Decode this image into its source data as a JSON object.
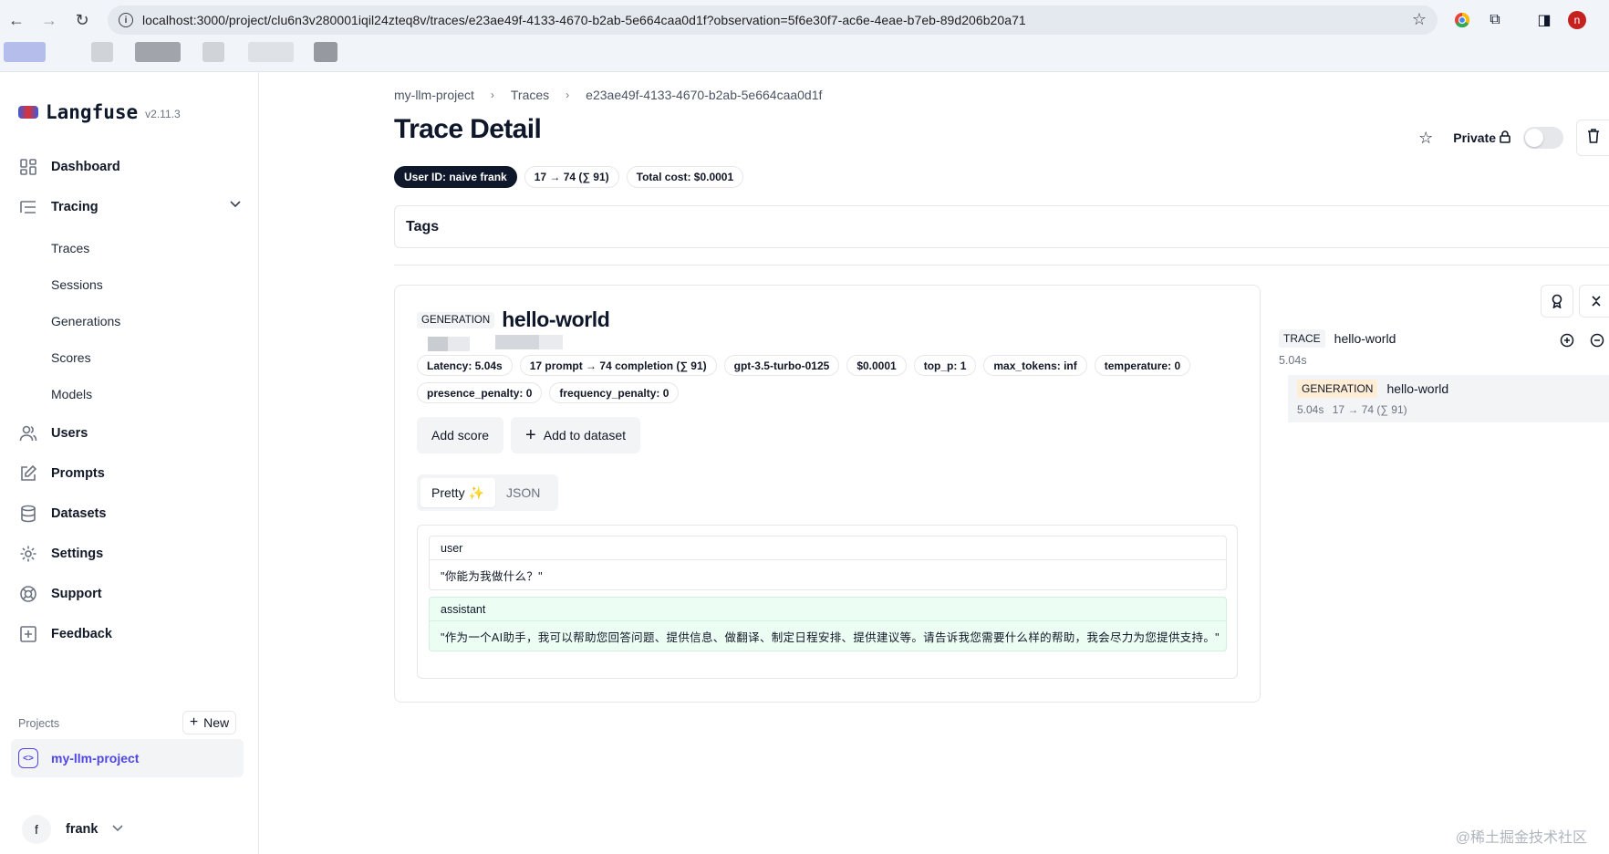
{
  "browser": {
    "url": "localhost:3000/project/clu6n3v280001iqil24zteq8v/traces/e23ae49f-4133-4670-b2ab-5e664caa0d1f?observation=5f6e30f7-ac6e-4eae-b7eb-89d206b20a71",
    "profile_initial": "n"
  },
  "sidebar": {
    "brand": "Langfuse",
    "version": "v2.11.3",
    "items": [
      {
        "label": "Dashboard",
        "icon": "dashboard-icon"
      },
      {
        "label": "Tracing",
        "icon": "tracing-icon"
      },
      {
        "label": "Users",
        "icon": "users-icon"
      },
      {
        "label": "Prompts",
        "icon": "prompts-icon"
      },
      {
        "label": "Datasets",
        "icon": "datasets-icon"
      },
      {
        "label": "Settings",
        "icon": "gear-icon"
      },
      {
        "label": "Support",
        "icon": "lifebuoy-icon"
      },
      {
        "label": "Feedback",
        "icon": "feedback-icon"
      }
    ],
    "tracing_sub": [
      "Traces",
      "Sessions",
      "Generations",
      "Scores",
      "Models"
    ],
    "projects_label": "Projects",
    "new_label": "New",
    "project": "my-llm-project",
    "user_initial": "f",
    "user_name": "frank"
  },
  "header": {
    "breadcrumb": [
      "my-llm-project",
      "Traces",
      "e23ae49f-4133-4670-b2ab-5e664caa0d1f"
    ],
    "title": "Trace Detail",
    "private_label": "Private",
    "badges": [
      "User ID: naive frank",
      "17 → 74 (∑ 91)",
      "Total cost: $0.0001"
    ],
    "tags_label": "Tags"
  },
  "observation": {
    "type": "GENERATION",
    "name": "hello-world",
    "badges": [
      "Latency: 5.04s",
      "17 prompt → 74 completion (∑ 91)",
      "gpt-3.5-turbo-0125",
      "$0.0001",
      "top_p: 1",
      "max_tokens: inf",
      "temperature: 0",
      "presence_penalty: 0",
      "frequency_penalty: 0"
    ],
    "add_score": "Add score",
    "add_dataset": "Add to dataset",
    "tabs": [
      "Pretty",
      "JSON"
    ],
    "sparkle": "✨",
    "messages": [
      {
        "role": "user",
        "content": "\"你能为我做什么？\""
      },
      {
        "role": "assistant",
        "content": "\"作为一个AI助手，我可以帮助您回答问题、提供信息、做翻译、制定日程安排、提供建议等。请告诉我您需要什么样的帮助，我会尽力为您提供支持。\""
      }
    ]
  },
  "tree": {
    "trace_type": "TRACE",
    "trace_name": "hello-world",
    "trace_latency": "5.04s",
    "gen_type": "GENERATION",
    "gen_name": "hello-world",
    "gen_latency": "5.04s",
    "gen_tokens": "17 → 74 (∑ 91)"
  },
  "watermark": "@稀土掘金技术社区"
}
